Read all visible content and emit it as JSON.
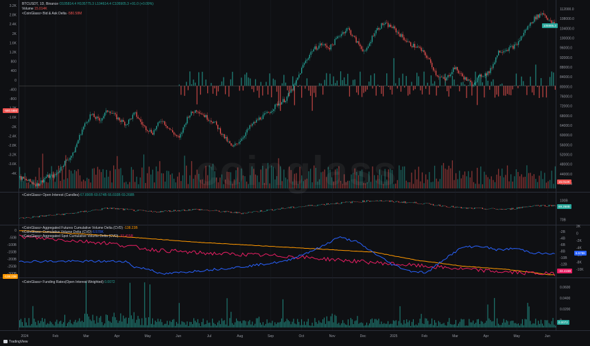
{
  "colors": {
    "bg": "#0f1013",
    "up": "#26a69a",
    "down": "#ef5350",
    "cvd_blue": "#2962ff",
    "cvd_orange": "#ff9800",
    "cvd_pink": "#e91e63",
    "grid": "#1c1f26",
    "funding": "#26a69a"
  },
  "legend": {
    "symbol": "BTCUSDT, 1D, Binance",
    "ohlc": "O105814.4 H105775.3 L104614.4 C105905.3 +91.0 (+0.09%)",
    "volume_name": "Volume",
    "volume_value": "15.014K",
    "delta_name": "<CoinGlass> Bid & Ask Delta",
    "delta_value": "-580.58M",
    "oi_name": "<CoinGlass> Open Interest (Candles)",
    "oi_value": "67.890B 69.674B 66.693B 69.268B",
    "cvd_futures_name": "<CoinGlass> Aggregated Futures Cumulative Volume Delta (CVD)",
    "cvd_futures_value": "-138.23B",
    "cvd_name": "<CoinGlass> Cumulative Volume Delta (CVD)",
    "cvd_value": "6.578K",
    "cvd_spot_name": "<CoinGlass> Aggregated Spot Cumulative Volume Delta (CVD)",
    "cvd_spot_value": "-33.415B",
    "funding_name": "<CoinGlass> Funding Rates(Open Interest Weighted)",
    "funding_value": "0.0072"
  },
  "watermark": "coinglass",
  "brand": "TradingView",
  "price_tags": {
    "last": "105905.3",
    "volume_tag": "15.014K",
    "delta_tag": "-580.58M",
    "oi_tag": "69.268B",
    "cvd_tag": "6.578K",
    "cvd_fut_tag": "-138.23B",
    "cvd_spot_tag": "-33.415B",
    "funding_tag": "0.0072"
  },
  "chart_data": {
    "type": "candlestick",
    "title": "BTCUSDT, 1D, Binance",
    "x_ticks": [
      "2024",
      "Feb",
      "Mar",
      "Apr",
      "May",
      "Jun",
      "Jul",
      "Aug",
      "Sep",
      "Oct",
      "Nov",
      "Dec",
      "2025",
      "Feb",
      "Mar",
      "Apr",
      "May",
      "Jun"
    ],
    "price_axis_ticks": [
      "112000.0",
      "108000.0",
      "104000.0",
      "100000.0",
      "96000.0",
      "92000.0",
      "88000.0",
      "84000.0",
      "80000.0",
      "76000.0",
      "72000.0",
      "68000.0",
      "64000.0",
      "60000.0",
      "56000.0",
      "52000.0",
      "48000.0",
      "44000.0",
      "40000.0"
    ],
    "delta_axis_ticks": [
      "3.2K",
      "2.8K",
      "2.4K",
      "2K",
      "1.6K",
      "1.2K",
      "800",
      "400",
      "0",
      "-400",
      "-800",
      "-1.2K",
      "-1.6K",
      "-2K",
      "-2.4K",
      "-2.8K",
      "-3.2K",
      "-3.6K",
      "-4K"
    ],
    "oi_axis_ticks": [
      "100B",
      "90B",
      "70B"
    ],
    "cvd_left_ticks": [
      "0",
      "-50B",
      "-100B",
      "-150B",
      "-200B",
      "-250B",
      "-300B"
    ],
    "cvd_mid_ticks": [
      "-2B",
      "-4B",
      "-6B",
      "-8B",
      "-10B",
      "-12B",
      "-14B"
    ],
    "cvd_right_ticks": [
      "2K",
      "0",
      "-2K",
      "-4K",
      "-6K",
      "-8K",
      "-10K"
    ],
    "funding_axis_ticks": [
      "0.0600",
      "0.0400",
      "0.0200",
      "0"
    ],
    "price_path": [
      [
        0,
        42500
      ],
      [
        10,
        41000
      ],
      [
        20,
        39500
      ],
      [
        30,
        42800
      ],
      [
        40,
        43200
      ],
      [
        50,
        48500
      ],
      [
        60,
        52000
      ],
      [
        70,
        62000
      ],
      [
        80,
        68500
      ],
      [
        90,
        66000
      ],
      [
        100,
        70500
      ],
      [
        110,
        67000
      ],
      [
        120,
        64500
      ],
      [
        130,
        69000
      ],
      [
        140,
        63500
      ],
      [
        150,
        61000
      ],
      [
        160,
        66500
      ],
      [
        170,
        62000
      ],
      [
        180,
        58500
      ],
      [
        190,
        68000
      ],
      [
        200,
        70500
      ],
      [
        210,
        67500
      ],
      [
        220,
        65000
      ],
      [
        230,
        59500
      ],
      [
        240,
        54800
      ],
      [
        250,
        58500
      ],
      [
        260,
        63500
      ],
      [
        270,
        66800
      ],
      [
        280,
        69000
      ],
      [
        290,
        72500
      ],
      [
        300,
        74800
      ],
      [
        310,
        80500
      ],
      [
        320,
        89000
      ],
      [
        330,
        95000
      ],
      [
        340,
        97500
      ],
      [
        350,
        96000
      ],
      [
        360,
        101000
      ],
      [
        370,
        104000
      ],
      [
        380,
        98500
      ],
      [
        390,
        94000
      ],
      [
        400,
        102500
      ],
      [
        410,
        106000
      ],
      [
        420,
        104500
      ],
      [
        430,
        101000
      ],
      [
        440,
        97500
      ],
      [
        450,
        96000
      ],
      [
        460,
        92000
      ],
      [
        470,
        85000
      ],
      [
        480,
        82500
      ],
      [
        490,
        88000
      ],
      [
        500,
        84000
      ],
      [
        510,
        81000
      ],
      [
        520,
        84500
      ],
      [
        530,
        86000
      ],
      [
        540,
        94500
      ],
      [
        550,
        95500
      ],
      [
        560,
        97000
      ],
      [
        570,
        103000
      ],
      [
        580,
        108000
      ],
      [
        590,
        110500
      ],
      [
        600,
        106000
      ],
      [
        605,
        105905
      ]
    ],
    "cvd_futures_path": [
      [
        0,
        -5
      ],
      [
        100,
        -20
      ],
      [
        200,
        -40
      ],
      [
        300,
        -55
      ],
      [
        400,
        -70
      ],
      [
        450,
        -95
      ],
      [
        500,
        -112
      ],
      [
        550,
        -122
      ],
      [
        600,
        -138
      ]
    ],
    "cvd_spot_path": [
      [
        0,
        -2
      ],
      [
        100,
        -4
      ],
      [
        150,
        -6
      ],
      [
        200,
        -7
      ],
      [
        250,
        -7.5
      ],
      [
        300,
        -8
      ],
      [
        350,
        -9
      ],
      [
        400,
        -10
      ],
      [
        450,
        -11
      ],
      [
        500,
        -12
      ],
      [
        550,
        -13
      ],
      [
        600,
        -13.5
      ],
      [
        605,
        -13.6
      ]
    ],
    "cvd_path": [
      [
        0,
        -5.5
      ],
      [
        120,
        -5.5
      ],
      [
        130,
        -6.5
      ],
      [
        150,
        -7
      ],
      [
        160,
        -7.8
      ],
      [
        200,
        -7.2
      ],
      [
        250,
        -6.5
      ],
      [
        300,
        -5.5
      ],
      [
        340,
        -3
      ],
      [
        360,
        -1.2
      ],
      [
        380,
        -2
      ],
      [
        400,
        -4
      ],
      [
        420,
        -6
      ],
      [
        440,
        -7.2
      ],
      [
        460,
        -7.5
      ],
      [
        480,
        -5
      ],
      [
        500,
        -3
      ],
      [
        520,
        -2.8
      ],
      [
        540,
        -3.5
      ],
      [
        560,
        -3.2
      ],
      [
        580,
        -4
      ],
      [
        600,
        -4.2
      ]
    ],
    "open_interest_path": [
      [
        0,
        72
      ],
      [
        60,
        80
      ],
      [
        100,
        88
      ],
      [
        150,
        82
      ],
      [
        200,
        86
      ],
      [
        250,
        80
      ],
      [
        300,
        88
      ],
      [
        350,
        95
      ],
      [
        400,
        100
      ],
      [
        450,
        96
      ],
      [
        500,
        88
      ],
      [
        550,
        86
      ],
      [
        580,
        92
      ],
      [
        600,
        92
      ]
    ]
  }
}
